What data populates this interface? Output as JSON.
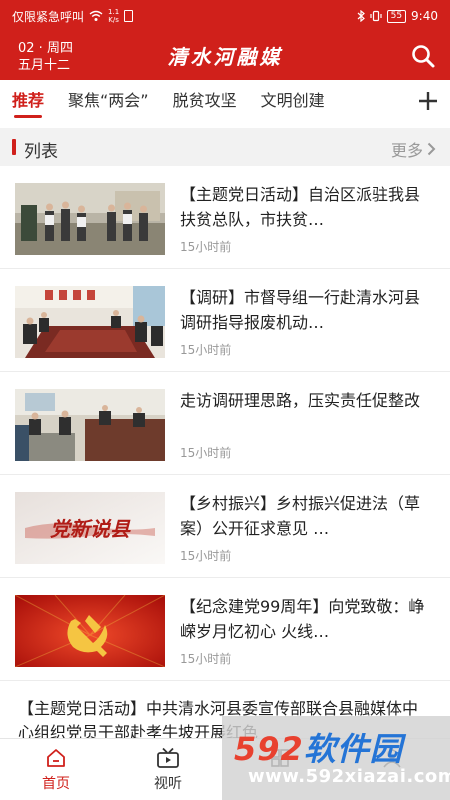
{
  "status_bar": {
    "carrier": "仅限紧急呼叫",
    "net_speed_top": "1.1",
    "net_speed_bottom": "K/s",
    "battery": "55",
    "time": "9:40"
  },
  "header": {
    "date_line1": "02 · 周四",
    "date_line2": "五月十二",
    "title": "清水河融媒"
  },
  "tabs": [
    {
      "label": "推荐",
      "active": true
    },
    {
      "label": "聚焦“两会”",
      "active": false
    },
    {
      "label": "脱贫攻坚",
      "active": false
    },
    {
      "label": "文明创建",
      "active": false
    },
    {
      "label": "",
      "active": false
    }
  ],
  "section": {
    "title": "列表",
    "more": "更多"
  },
  "news": [
    {
      "title": "【主题党日活动】自治区派驻我县扶贫总队，市扶贫…",
      "time": "15小时前"
    },
    {
      "title": "【调研】市督导组一行赴清水河县调研指导报废机动…",
      "time": "15小时前"
    },
    {
      "title": "走访调研理思路，压实责任促整改",
      "time": "15小时前"
    },
    {
      "title": "【乡村振兴】乡村振兴促进法（草案）公开征求意见 …",
      "time": "15小时前"
    },
    {
      "title": "【纪念建党99周年】向党致敬：峥嵘岁月忆初心 火线…",
      "time": "15小时前"
    }
  ],
  "wide_news": {
    "title": "【主题党日活动】中共清水河县委宣传部联合县融媒体中心组织党员干部赴孝牛坡开展红色"
  },
  "thumb_text": {
    "calligraphy": "党新说县"
  },
  "bottom_nav": [
    {
      "label": "首页",
      "active": true
    },
    {
      "label": "视听",
      "active": false
    },
    {
      "label": "",
      "active": false
    },
    {
      "label": "",
      "active": false
    }
  ],
  "watermark": {
    "brand_num": "592",
    "brand_text": "软件园",
    "url": "www.592xiazai.com"
  },
  "colors": {
    "brand_red": "#d0201b",
    "muted_gray": "#999999",
    "section_bg": "#f2f2f2"
  }
}
